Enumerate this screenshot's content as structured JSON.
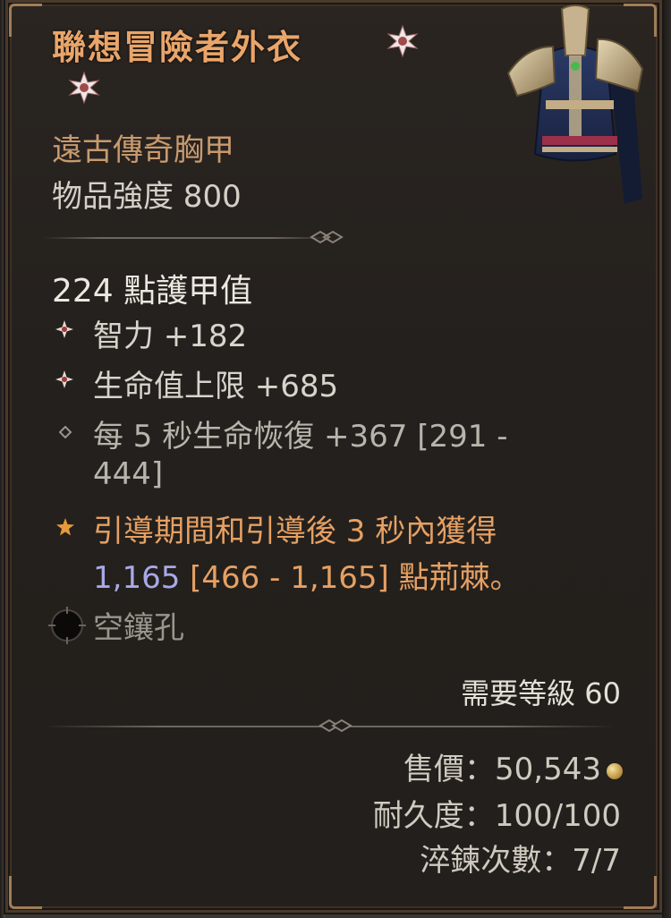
{
  "item": {
    "name": "聯想冒險者外衣",
    "type": "遠古傳奇胸甲",
    "power": "物品強度 800",
    "armor": "224 點護甲值",
    "stats": [
      {
        "icon": "diamond-star-icon",
        "text": "智力 +182"
      },
      {
        "icon": "diamond-star-icon",
        "text": "生命值上限 +685"
      },
      {
        "icon": "small-diamond-icon",
        "line1": "每 5 秒生命恢復 +367 [291 -",
        "line2": "444]"
      }
    ],
    "legendary": {
      "icon": "legendary-star-icon",
      "line1": "引導期間和引導後 3 秒內獲得",
      "line2_value": "1,165",
      "line2_range": " [466 - 1,165] 點荊棘。"
    },
    "socket": {
      "icon": "empty-socket-icon",
      "label": "空鑲孔"
    },
    "required_level": "需要等級 60",
    "sell_price": "售價：50,543",
    "durability": "耐久度：100/100",
    "temper": "淬鍊次數：7/7"
  },
  "colors": {
    "title": "#e9a56a",
    "legendary_text": "#e6a063",
    "thorns_value": "#a9a8e8"
  }
}
